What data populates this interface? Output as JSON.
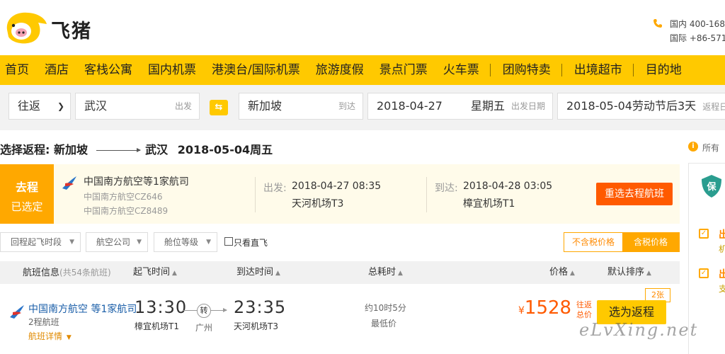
{
  "header": {
    "brand": "飞猪",
    "hotline_domestic": "国内  400-168",
    "hotline_intl": "国际  +86-571"
  },
  "nav": {
    "items": [
      "首页",
      "酒店",
      "客栈公寓",
      "国内机票",
      "港澳台/国际机票",
      "旅游度假",
      "景点门票",
      "火车票",
      "团购特卖",
      "出境超市",
      "目的地"
    ]
  },
  "search": {
    "trip_type": "往返",
    "from_city": "武汉",
    "from_hint": "出发",
    "to_city": "新加坡",
    "to_hint": "到达",
    "depart_date": "2018-04-27",
    "depart_weekday": "星期五",
    "depart_hint": "出发日期",
    "return_date": "2018-05-04劳动节后3天",
    "return_hint": "返程日"
  },
  "route": {
    "label": "选择返程:",
    "from": "新加坡",
    "to": "武汉",
    "date": "2018-05-04周五"
  },
  "outbound": {
    "tag_title": "去程",
    "tag_status": "已选定",
    "airline": "中国南方航空等1家航司",
    "flight_1": "中国南方航空CZ646",
    "flight_2": "中国南方航空CZ8489",
    "depart_label": "出发:",
    "depart_time": "2018-04-27 08:35",
    "depart_airport": "天河机场T3",
    "arrive_label": "到达:",
    "arrive_time": "2018-04-28 03:05",
    "arrive_airport": "樟宜机场T1",
    "reselect_label": "重选去程航班"
  },
  "filters": {
    "dropdowns": [
      "回程起飞时段",
      "航空公司",
      "舱位等级"
    ],
    "direct_only": "只看直飞",
    "price_excl_tax": "不含税价格",
    "price_incl_tax": "含税价格"
  },
  "table": {
    "col_flight": "航班信息",
    "col_flight_count": "(共54条航班)",
    "col_depart": "起飞时间",
    "col_arrive": "到达时间",
    "col_duration": "总耗时",
    "col_price": "价格",
    "col_sort": "默认排序"
  },
  "flights": [
    {
      "airline": "中国南方航空 等1家航司",
      "segments": "2程航班",
      "detail_link": "航班详情",
      "depart_time": "13:30",
      "depart_airport": "樟宜机场T1",
      "transfer_mark": "转",
      "transfer_city": "广州",
      "arrive_time": "23:35",
      "arrive_airport": "天河机场T3",
      "duration": "约10时5分",
      "cheapest_tag": "最低价",
      "currency": "¥",
      "price": "1528",
      "price_note_1": "往返",
      "price_note_2": "总价",
      "select_label": "选为返程",
      "tickets_left": "2张"
    }
  ],
  "sidebar": {
    "info": "所有",
    "check_1": "出",
    "check_1_sub": "机",
    "check_2": "出",
    "check_2_sub": "支"
  },
  "watermark": "eLvXing.net",
  "colors": {
    "brand_yellow": "#ffc900",
    "accent_orange": "#ffa800",
    "price_red": "#ff5a00",
    "link_blue": "#1a5ea8"
  }
}
